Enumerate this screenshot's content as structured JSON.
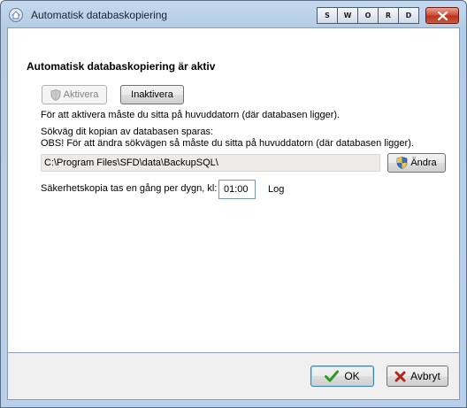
{
  "window": {
    "title": "Automatisk databaskopiering"
  },
  "sword_buttons": [
    "S",
    "W",
    "O",
    "R",
    "D"
  ],
  "main": {
    "heading": "Automatisk databaskopiering är aktiv",
    "activate_label": "Aktivera",
    "deactivate_label": "Inaktivera",
    "activate_hint": "För att aktivera måste du sitta på huvuddatorn (där databasen ligger).",
    "path_label": "Sökväg dit kopian av databasen sparas:",
    "path_note": "OBS! För att ändra sökvägen så måste du sitta på huvuddatorn (där databasen ligger).",
    "path_value": "C:\\Program Files\\SFD\\data\\BackupSQL\\",
    "change_label": "Ändra",
    "schedule_label": "Säkerhetskopia tas en gång per dygn, kl:",
    "schedule_time": "01:00",
    "log_label": "Log"
  },
  "footer": {
    "ok_label": "OK",
    "cancel_label": "Avbryt"
  },
  "colors": {
    "ok_check": "#2e9a22",
    "cancel_x": "#b3251a",
    "close_button": "#c8432c"
  },
  "icons": [
    "home-icon",
    "close-icon",
    "shield-icon",
    "checkmark-icon",
    "cancel-x-icon"
  ]
}
